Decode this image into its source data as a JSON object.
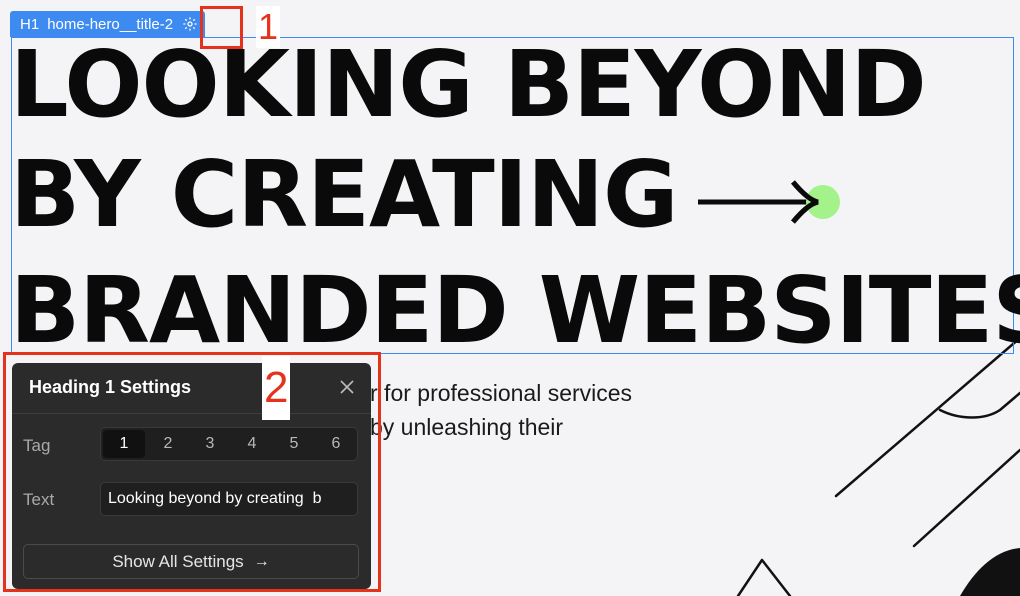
{
  "selector": {
    "tag": "H1",
    "class_name": "home-hero__title-2"
  },
  "hero": {
    "title_lines": [
      "LOOKING BEYOND",
      "BY CREATING",
      "BRANDED WEBSITES"
    ],
    "accent_color": "#a4f28a",
    "subtitle_lines": [
      "r for professional services",
      "by unleashing their"
    ]
  },
  "annotations": {
    "marker_1": "1",
    "marker_2": "2",
    "color": "#e5321b"
  },
  "popover": {
    "title": "Heading 1 Settings",
    "close_icon": "close-icon",
    "tag_label": "Tag",
    "tag_options": [
      "1",
      "2",
      "3",
      "4",
      "5",
      "6"
    ],
    "tag_selected": "1",
    "text_label": "Text",
    "text_value": "Looking beyond by creating  b",
    "show_all_label": "Show All Settings",
    "show_all_arrow": "→"
  },
  "colors": {
    "selection_blue": "#3d8bf0",
    "panel_bg": "#2b2b2b",
    "canvas_bg": "#f4f4f6"
  }
}
